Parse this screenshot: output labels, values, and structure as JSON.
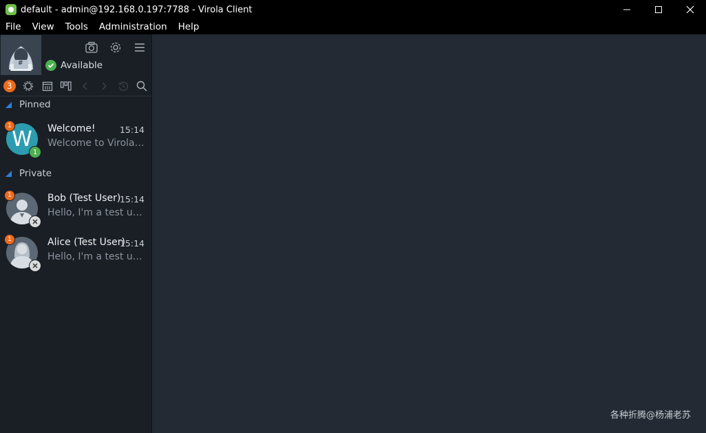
{
  "window": {
    "title": "default - admin@192.168.0.197:7788 - Virola Client",
    "controls": {
      "minimize": "minimize-icon",
      "maximize": "maximize-icon",
      "close": "close-icon"
    }
  },
  "menu": [
    "File",
    "View",
    "Tools",
    "Administration",
    "Help"
  ],
  "profile": {
    "status": "Available",
    "status_color": "#4cb050",
    "avatar_symbol": "#"
  },
  "toolbar": {
    "unread_count": "3",
    "icons": [
      "settings-cog-icon",
      "calendar-icon",
      "tasks-icon",
      "back-icon",
      "forward-icon",
      "history-icon",
      "search-icon"
    ]
  },
  "sections": {
    "pinned": "Pinned",
    "private": "Private"
  },
  "chats": [
    {
      "name": "Welcome!",
      "time": "15:14",
      "preview": "Welcome to Virola ...",
      "unread": "1",
      "member_count": "1",
      "avatar_letter": "W"
    },
    {
      "name": "Bob (Test User)",
      "time": "15:14",
      "preview": "Hello, I'm a test use...",
      "unread": "1"
    },
    {
      "name": "Alice (Test User)",
      "time": "15:14",
      "preview": "Hello, I'm a test use...",
      "unread": "1"
    }
  ],
  "watermark": "各种折腾@杨浦老苏",
  "colors": {
    "accent_orange": "#ee6a1c",
    "online_green": "#4cb050",
    "accent_blue": "#2f7fd8",
    "teal_avatar": "#2d9cb0"
  }
}
